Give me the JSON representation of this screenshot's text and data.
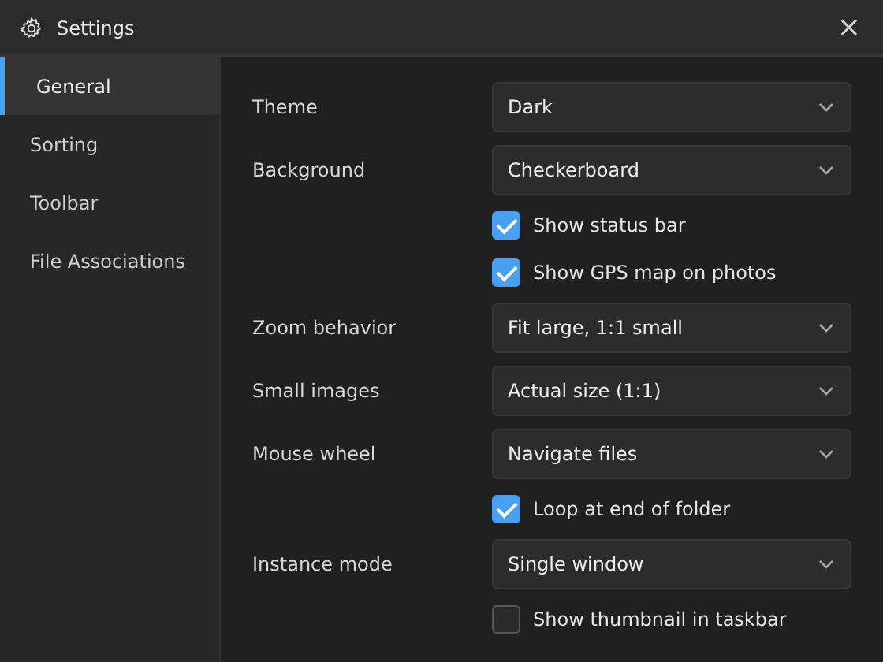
{
  "window": {
    "title": "Settings",
    "close": "×"
  },
  "sidebar": {
    "items": [
      {
        "label": "General",
        "selected": true
      },
      {
        "label": "Sorting",
        "selected": false
      },
      {
        "label": "Toolbar",
        "selected": false
      },
      {
        "label": "File Associations",
        "selected": false
      }
    ]
  },
  "settings": [
    {
      "kind": "dropdown",
      "label": "Theme",
      "value": "Dark"
    },
    {
      "kind": "dropdown",
      "label": "Background",
      "value": "Checkerboard"
    },
    {
      "kind": "checkbox",
      "label": "Show status bar",
      "checked": true
    },
    {
      "kind": "checkbox",
      "label": "Show GPS map on photos",
      "checked": true
    },
    {
      "kind": "dropdown",
      "label": "Zoom behavior",
      "value": "Fit large, 1:1 small"
    },
    {
      "kind": "dropdown",
      "label": "Small images",
      "value": "Actual size (1:1)"
    },
    {
      "kind": "dropdown",
      "label": "Mouse wheel",
      "value": "Navigate files"
    },
    {
      "kind": "checkbox",
      "label": "Loop at end of folder",
      "checked": true
    },
    {
      "kind": "dropdown",
      "label": "Instance mode",
      "value": "Single window"
    },
    {
      "kind": "checkbox",
      "label": "Show thumbnail in taskbar",
      "checked": false
    }
  ]
}
